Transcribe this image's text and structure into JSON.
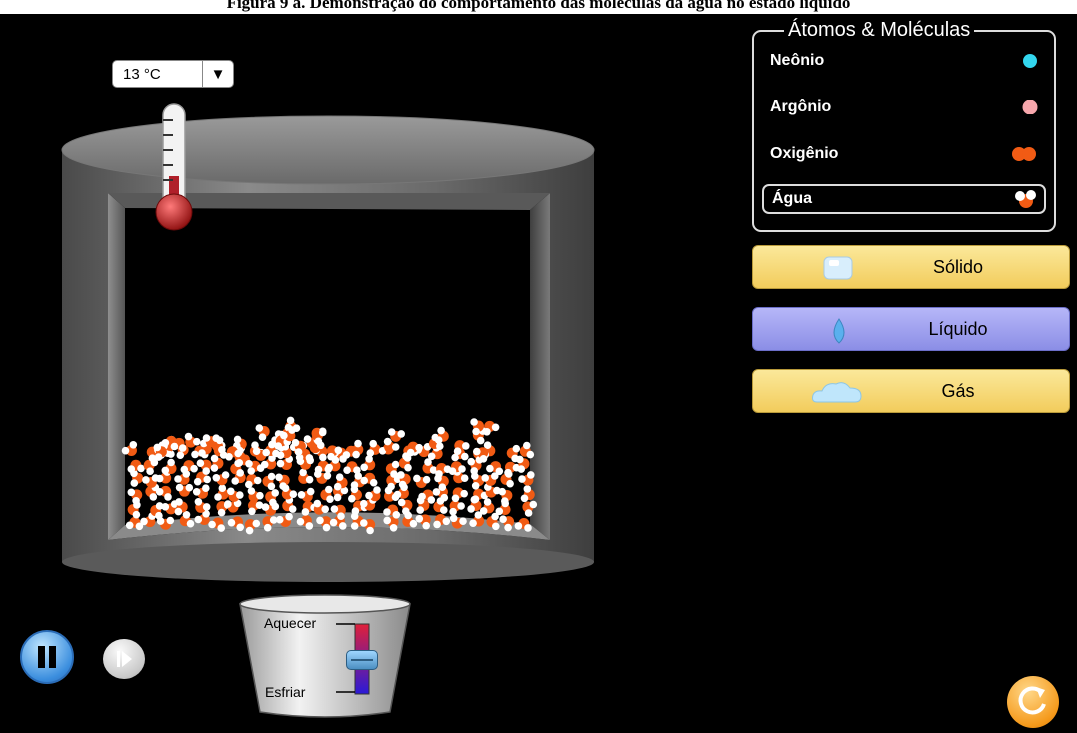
{
  "caption": "Figura 9 a. Demonstração do comportamento das moléculas da água no estado líquido",
  "temperature": {
    "value": "13 °C",
    "dropdown_icon": "triangle-down"
  },
  "atoms_panel": {
    "title": "Átomos & Moléculas",
    "items": [
      {
        "label": "Neônio",
        "color": "#33d6ee",
        "selected": false
      },
      {
        "label": "Argônio",
        "color": "#f7a7ac",
        "selected": false
      },
      {
        "label": "Oxigênio",
        "color": "#f15b14",
        "selected": false
      },
      {
        "label": "Água",
        "color": "#f15b14",
        "selected": true
      }
    ]
  },
  "phases": {
    "solid": {
      "label": "Sólido",
      "icon": "ice-cube-icon"
    },
    "liquid": {
      "label": "Líquido",
      "icon": "water-drop-icon"
    },
    "gas": {
      "label": "Gás",
      "icon": "cloud-icon"
    }
  },
  "heater": {
    "heat_label": "Aquecer",
    "cool_label": "Esfriar",
    "level": 0.5
  },
  "colors": {
    "oxygen": "#f15b14",
    "hydrogen": "#ffffff",
    "container": "#6e6e6e"
  }
}
